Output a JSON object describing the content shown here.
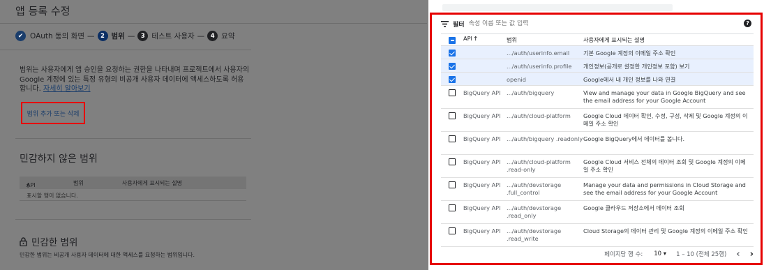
{
  "left": {
    "title": "앱 등록 수정",
    "steps": [
      {
        "label": "OAuth 동의 화면",
        "num": ""
      },
      {
        "label": "범위",
        "num": "2"
      },
      {
        "label": "테스트 사용자",
        "num": "3"
      },
      {
        "label": "요약",
        "num": "4"
      }
    ],
    "desc_text": "범위는 사용자에게 앱 승인을 요청하는 권한을 나타내며 프로젝트에서 사용자의 Google 계정에 있는 특정 유형의 비공개 사용자 데이터에 액세스하도록 허용합니다.",
    "learn_more": "자세히 알아보기",
    "add_button": "범위 추가 또는 삭제",
    "nonsensitive": {
      "title": "민감하지 않은 범위",
      "col_api": "API",
      "col_scope": "범위",
      "col_desc": "사용자에게 표시되는 설명",
      "empty": "표시할 행이 없습니다."
    },
    "sensitive": {
      "title": "민감한 범위",
      "desc": "민감한 범위는 비공개 사용자 데이터에 대한 액세스를 요청하는 범위입니다."
    }
  },
  "panel": {
    "filter_label": "필터",
    "filter_placeholder": "속성 이름 또는 값 입력",
    "help_glyph": "?",
    "columns": {
      "api": "API",
      "scope": "범위",
      "desc": "사용자에게 표시되는 설명"
    },
    "rows": [
      {
        "checked": true,
        "api": "",
        "scope": ".../auth/userinfo.email",
        "desc": "기본 Google 계정의 이메일 주소 확인"
      },
      {
        "checked": true,
        "api": "",
        "scope": ".../auth/userinfo.profile",
        "desc": "개인정보(공개로 설정한 개인정보 포함) 보기"
      },
      {
        "checked": true,
        "api": "",
        "scope": "openid",
        "desc": "Google에서 내 개인 정보를 나와 연결"
      },
      {
        "checked": false,
        "api": "BigQuery API",
        "scope": ".../auth/bigquery",
        "desc": "View and manage your data in Google BigQuery and see the email address for your Google Account"
      },
      {
        "checked": false,
        "api": "BigQuery API",
        "scope": ".../auth/cloud-platform",
        "desc": "Google Cloud 데이터 확인, 수정, 구성, 삭제 및 Google 계정의 이메일 주소 확인"
      },
      {
        "checked": false,
        "api": "BigQuery API",
        "scope": ".../auth/bigquery .readonly",
        "desc": "Google BigQuery에서 데이터를 봅니다."
      },
      {
        "checked": false,
        "api": "BigQuery API",
        "scope": ".../auth/cloud-platform .read-only",
        "desc": "Google Cloud 서비스 전체의 데이터 조회 및 Google 계정의 이메일 주소 확인"
      },
      {
        "checked": false,
        "api": "BigQuery API",
        "scope": ".../auth/devstorage .full_control",
        "desc": "Manage your data and permissions in Cloud Storage and see the email address for your Google Account"
      },
      {
        "checked": false,
        "api": "BigQuery API",
        "scope": ".../auth/devstorage .read_only",
        "desc": "Google 클라우드 저장소에서 데이터 조회"
      },
      {
        "checked": false,
        "api": "BigQuery API",
        "scope": ".../auth/devstorage .read_write",
        "desc": "Cloud Storage의 데이터 관리 및 Google 계정의 이메일 주소 확인"
      }
    ],
    "pager": {
      "rows_per_page_label": "페이지당 행 수:",
      "rows_per_page": "10",
      "range": "1 – 10 (전체 25행)"
    }
  },
  "colors": {
    "highlight": "#e60000",
    "accent": "#1a73e8",
    "selected_row": "#e8f0fe"
  },
  "icons": [
    "check-circle-icon",
    "sort-up-arrow-icon",
    "filter-icon",
    "help-icon",
    "lock-icon",
    "dropdown-arrow-icon",
    "chevron-left-icon",
    "chevron-right-icon"
  ]
}
